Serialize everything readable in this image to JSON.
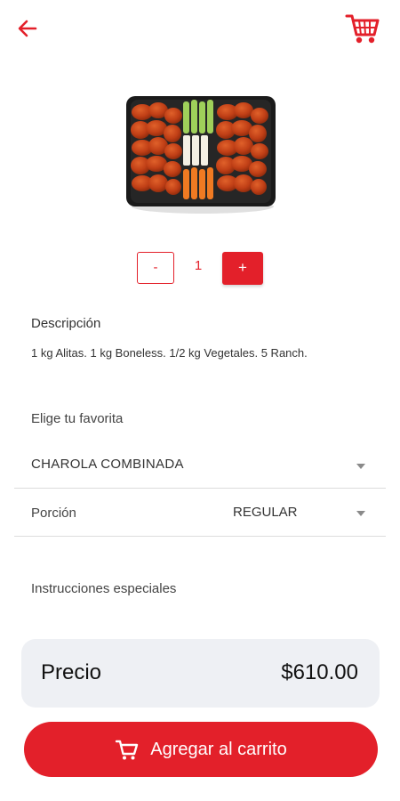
{
  "colors": {
    "accent": "#e3202a",
    "price_card_bg": "#eef0f4",
    "divider": "#dcdcdc",
    "text": "#333333"
  },
  "header": {
    "back_icon": "arrow-left-icon",
    "cart_icon": "shopping-cart-icon"
  },
  "product": {
    "image": "wings-platter-image"
  },
  "quantity": {
    "minus_label": "-",
    "value": "1",
    "plus_label": "+"
  },
  "description": {
    "label": "Descripción",
    "text": "1 kg Alitas. 1 kg Boneless. 1/2 kg Vegetales. 5 Ranch."
  },
  "favorite": {
    "label": "Elige tu favorita",
    "selected": "CHAROLA COMBINADA"
  },
  "portion": {
    "label": "Porción",
    "selected": "REGULAR"
  },
  "instructions": {
    "label": "Instrucciones especiales"
  },
  "price": {
    "label": "Precio",
    "value": "$610.00"
  },
  "add_to_cart": {
    "label": "Agregar al carrito",
    "icon": "shopping-cart-icon"
  }
}
